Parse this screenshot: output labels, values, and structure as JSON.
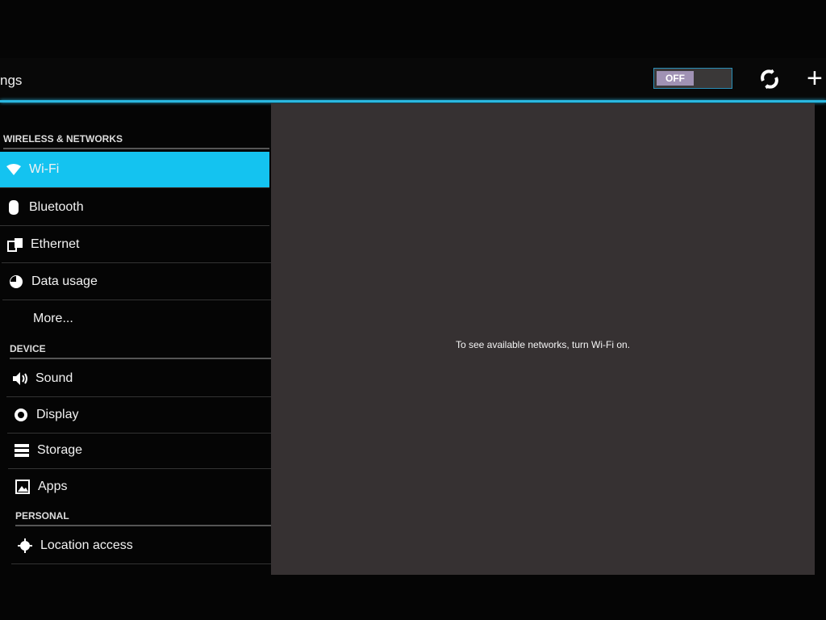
{
  "actionbar": {
    "title": "ngs",
    "wifi_toggle": "OFF",
    "sync_icon": "sync-icon",
    "add_icon": "plus-icon"
  },
  "sidebar": {
    "sections": [
      {
        "header": "WIRELESS & NETWORKS"
      },
      {
        "header": "DEVICE"
      },
      {
        "header": "PERSONAL"
      }
    ],
    "items": [
      {
        "label": "Wi-Fi",
        "icon": "wifi-icon",
        "selected": true
      },
      {
        "label": "Bluetooth",
        "icon": "bluetooth-icon"
      },
      {
        "label": "Ethernet",
        "icon": "ethernet-icon"
      },
      {
        "label": "Data usage",
        "icon": "data-usage-icon"
      },
      {
        "label": "More..."
      },
      {
        "label": "Sound",
        "icon": "sound-icon"
      },
      {
        "label": "Display",
        "icon": "display-icon"
      },
      {
        "label": "Storage",
        "icon": "storage-icon"
      },
      {
        "label": "Apps",
        "icon": "apps-icon"
      },
      {
        "label": "Location access",
        "icon": "location-icon"
      }
    ]
  },
  "content": {
    "message": "To see available networks, turn Wi-Fi on."
  },
  "colors": {
    "accent": "#14c3f0",
    "pane": "#363132"
  }
}
